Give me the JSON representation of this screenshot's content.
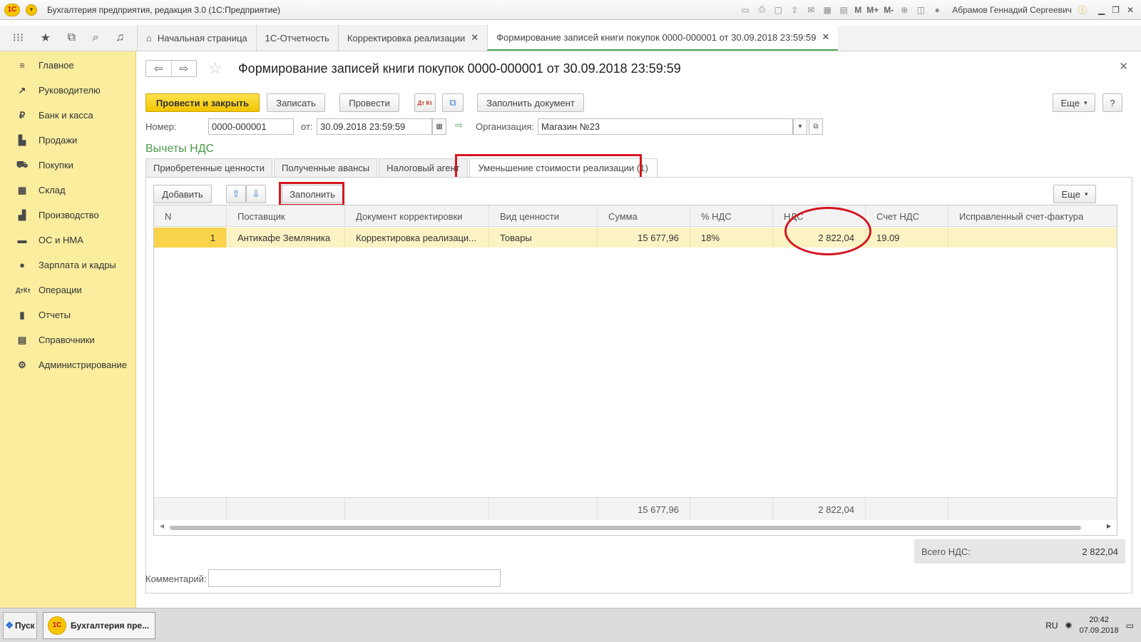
{
  "window": {
    "title": "Бухгалтерия предприятия, редакция 3.0  (1С:Предприятие)",
    "user": "Абрамов Геннадий Сергеевич",
    "toolbar_m": [
      "M",
      "M+",
      "M-"
    ]
  },
  "tabs": [
    {
      "label": "Начальная страница",
      "icon": "home-icon",
      "closable": false
    },
    {
      "label": "1С-Отчетность",
      "closable": false
    },
    {
      "label": "Корректировка реализации",
      "closable": true
    },
    {
      "label": "Формирование записей книги покупок 0000-000001 от 30.09.2018 23:59:59",
      "closable": true,
      "active": true
    }
  ],
  "sidebar": {
    "items": [
      {
        "label": "Главное",
        "icon": "menu-icon"
      },
      {
        "label": "Руководителю",
        "icon": "trend-icon"
      },
      {
        "label": "Банк и касса",
        "icon": "ruble-icon"
      },
      {
        "label": "Продажи",
        "icon": "store-icon"
      },
      {
        "label": "Покупки",
        "icon": "cart-icon"
      },
      {
        "label": "Склад",
        "icon": "grid-icon"
      },
      {
        "label": "Производство",
        "icon": "factory-icon"
      },
      {
        "label": "ОС и НМА",
        "icon": "truck-icon"
      },
      {
        "label": "Зарплата и кадры",
        "icon": "person-icon"
      },
      {
        "label": "Операции",
        "icon": "dt-kt-icon"
      },
      {
        "label": "Отчеты",
        "icon": "bar-chart-icon"
      },
      {
        "label": "Справочники",
        "icon": "book-icon"
      },
      {
        "label": "Администрирование",
        "icon": "gear-icon"
      }
    ]
  },
  "document": {
    "title": "Формирование записей книги покупок 0000-000001 от 30.09.2018 23:59:59",
    "buttons": {
      "post_close": "Провести и закрыть",
      "save": "Записать",
      "post": "Провести",
      "fill_document": "Заполнить документ",
      "more": "Еще",
      "help": "?",
      "dtkt": "Дт Кт"
    },
    "number_label": "Номер:",
    "number": "0000-000001",
    "date_label": "от:",
    "date": "30.09.2018 23:59:59",
    "org_label": "Организация:",
    "org": "Магазин №23",
    "group_title": "Вычеты НДС",
    "tabs": [
      "Приобретенные ценности",
      "Полученные авансы",
      "Налоговый агент",
      "Уменьшение стоимости реализации (1)"
    ],
    "table_toolbar": {
      "add": "Добавить",
      "fill": "Заполнить",
      "more": "Еще"
    },
    "columns": [
      "N",
      "Поставщик",
      "Документ корректировки",
      "Вид ценности",
      "Сумма",
      "% НДС",
      "НДС",
      "Счет НДС",
      "Исправленный счет-фактура"
    ],
    "rows": [
      {
        "n": "1",
        "supplier": "Антикафе Земляника",
        "doc": "Корректировка реализаци...",
        "kind": "Товары",
        "sum": "15 677,96",
        "rate": "18%",
        "vat": "2 822,04",
        "account": "19.09",
        "invoice": ""
      }
    ],
    "totals": {
      "sum": "15 677,96",
      "vat": "2 822,04"
    },
    "total_vat_label": "Всего НДС:",
    "total_vat": "2 822,04",
    "comment_label": "Комментарий:",
    "comment": ""
  },
  "taskbar": {
    "start": "Пуск",
    "task": "Бухгалтерия пре...",
    "lang": "RU",
    "time": "20:42",
    "date": "07.09.2018"
  },
  "colors": {
    "sidebar_bg": "#fbed9e",
    "primary_button": "#f2c400",
    "selected_row": "#fbf3c4",
    "group_title": "#4c9a4c",
    "highlight_red": "#d4161f"
  }
}
